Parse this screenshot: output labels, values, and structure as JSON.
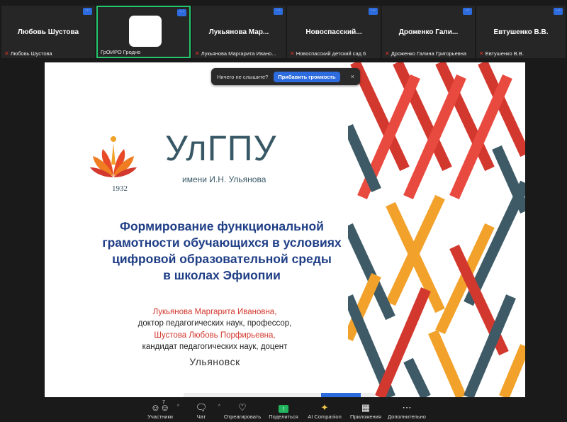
{
  "participants": [
    {
      "name": "Любовь Шустова",
      "footer": "Любовь Шустова",
      "muted": true
    },
    {
      "name": "",
      "footer": "ГрОИРО Гродно",
      "muted": false,
      "active": true
    },
    {
      "name": "Лукьянова  Мар...",
      "footer": "Лукьянова Маргарита Ивано...",
      "muted": true
    },
    {
      "name": "Новоспасский...",
      "footer": "Новоспасский детский сад 6",
      "muted": true
    },
    {
      "name": "Дроженко  Гали...",
      "footer": "Дроженко Галина Григорьевна",
      "muted": true
    },
    {
      "name": "Евтушенко В.В.",
      "footer": "Евтушенко В.В.",
      "muted": true
    }
  ],
  "more_icon": "ellipsis-icon",
  "audio_prompt": {
    "question": "Ничего не слышите?",
    "button": "Прибавить громкость",
    "close": "×"
  },
  "slide": {
    "logo_text": "УлГПУ",
    "logo_subtitle": "имени И.Н. Ульянова",
    "logo_year": "1932",
    "title_lines": [
      "Формирование функциональной",
      "грамотности обучающихся в условиях",
      "цифровой образовательной среды",
      "в школах Эфиопии"
    ],
    "authors": [
      {
        "text": "Лукьянова Маргарита Ивановна,",
        "style": "red"
      },
      {
        "text": "доктор педагогических наук, профессор,",
        "style": "dark"
      },
      {
        "text": "Шустова Любовь Порфирьевна,",
        "style": "red"
      },
      {
        "text": "кандидат педагогических наук, доцент",
        "style": "dark"
      }
    ],
    "city": "Ульяновск",
    "colors": {
      "title": "#1f3e86",
      "red": "#d3382e",
      "orange": "#f2a22b",
      "slate": "#3d5a66"
    }
  },
  "toolbar": {
    "items": [
      {
        "label": "Участники",
        "icon": "participants-icon",
        "badge": "7",
        "caret": true
      },
      {
        "label": "Чат",
        "icon": "chat-icon",
        "caret": true
      },
      {
        "label": "Отреагировать",
        "icon": "heart-icon",
        "caret": false
      },
      {
        "label": "Поделиться",
        "icon": "share-icon",
        "caret": false
      },
      {
        "label": "AI Companion",
        "icon": "sparkle-icon",
        "caret": false
      },
      {
        "label": "Приложения",
        "icon": "apps-icon",
        "caret": false
      },
      {
        "label": "Дополнительно",
        "icon": "more-icon",
        "caret": false
      }
    ]
  }
}
